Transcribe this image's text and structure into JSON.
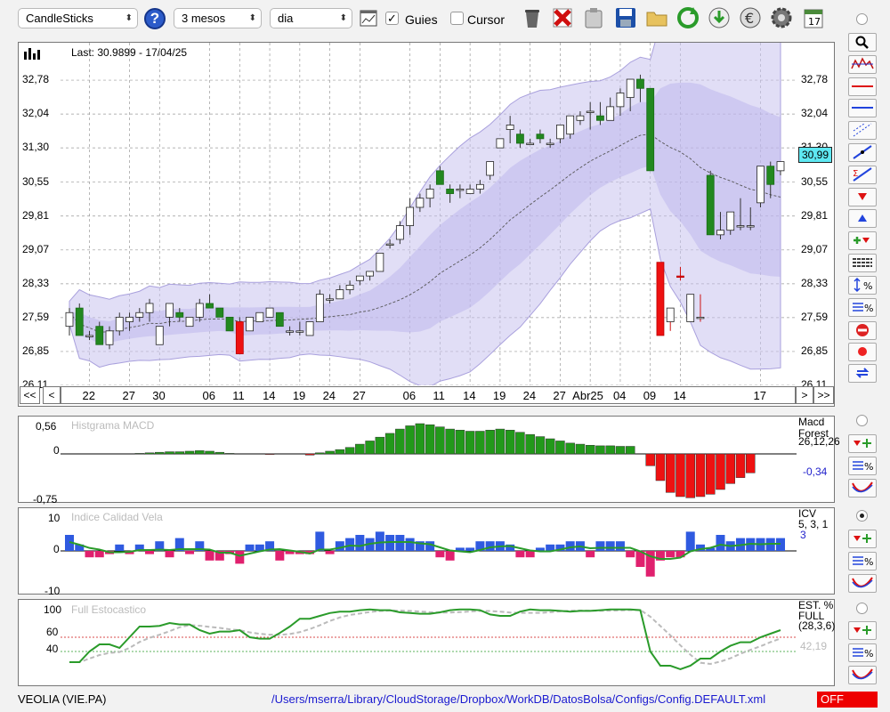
{
  "toolbar": {
    "chart_type": "CandleSticks",
    "period": "3 mesos",
    "interval": "dia",
    "guides_label": "Guies",
    "cursor_label": "Cursor"
  },
  "main_chart": {
    "last_label": "Last: 30.9899 - 17/04/25",
    "y_ticks": [
      "32,78",
      "32,04",
      "31,30",
      "30,55",
      "29,81",
      "29,07",
      "28,33",
      "27,59",
      "26,85",
      "26,11"
    ],
    "current_price": "30,99",
    "x_ticks": [
      "22",
      "27",
      "30",
      "06",
      "11",
      "14",
      "19",
      "24",
      "27",
      "06",
      "11",
      "14",
      "19",
      "24",
      "27",
      "Abr25",
      "04",
      "09",
      "14",
      "17"
    ],
    "nav": [
      "<<",
      "<",
      ">",
      ">>"
    ]
  },
  "macd": {
    "title": "Histgrama MACD",
    "y_ticks": [
      "0,56",
      "0",
      "-0,75"
    ],
    "side_name": "Macd",
    "side_name2": "Forest",
    "side_params": "26,12,26",
    "side_value": "-0,34"
  },
  "icv": {
    "title": "Indice Calidad Vela",
    "y_ticks": [
      "10",
      "0",
      "-10"
    ],
    "side_name": "ICV",
    "side_params": "5, 3, 1",
    "side_value": "3"
  },
  "stoch": {
    "title": "Full Estocastico",
    "y_ticks": [
      "100",
      "60",
      "40"
    ],
    "side_name": "EST. %",
    "side_name2": "FULL",
    "side_params": "(28,3,6)",
    "side_value": "42,19"
  },
  "footer": {
    "ticker": "VEOLIA (VIE.PA)",
    "path": "/Users/mserra/Library/CloudStorage/Dropbox/WorkDB/DatosBolsa/Configs/Config.DEFAULT.xml",
    "status": "OFF"
  },
  "chart_data": {
    "type": "candlestick",
    "ylim": [
      26.11,
      33.52
    ],
    "candles": [
      [
        27.4,
        27.8,
        27.2,
        27.7
      ],
      [
        27.8,
        27.9,
        27.2,
        27.2
      ],
      [
        27.2,
        27.3,
        27.1,
        27.2
      ],
      [
        27.4,
        27.5,
        27.0,
        27.0
      ],
      [
        27.0,
        27.4,
        26.9,
        27.3
      ],
      [
        27.3,
        27.7,
        27.2,
        27.6
      ],
      [
        27.5,
        27.7,
        27.3,
        27.6
      ],
      [
        27.6,
        27.8,
        27.5,
        27.7
      ],
      [
        27.7,
        28.0,
        27.5,
        27.9
      ],
      [
        27.0,
        27.4,
        27.0,
        27.4
      ],
      [
        27.6,
        27.9,
        27.4,
        27.9
      ],
      [
        27.7,
        27.8,
        27.5,
        27.6
      ],
      [
        27.4,
        27.6,
        27.4,
        27.6
      ],
      [
        27.6,
        28.0,
        27.5,
        27.9
      ],
      [
        27.9,
        28.1,
        27.8,
        27.8
      ],
      [
        27.8,
        27.8,
        27.6,
        27.6
      ],
      [
        27.6,
        27.6,
        27.3,
        27.3
      ],
      [
        27.5,
        27.6,
        26.8,
        26.8
      ],
      [
        27.3,
        27.6,
        27.3,
        27.6
      ],
      [
        27.5,
        27.7,
        27.5,
        27.7
      ],
      [
        27.6,
        27.8,
        27.6,
        27.8
      ],
      [
        27.7,
        27.7,
        27.4,
        27.4
      ],
      [
        27.3,
        27.4,
        27.2,
        27.3
      ],
      [
        27.3,
        27.5,
        27.2,
        27.3
      ],
      [
        27.2,
        27.5,
        27.2,
        27.5
      ],
      [
        27.5,
        28.2,
        27.5,
        28.1
      ],
      [
        28.0,
        28.1,
        27.9,
        28.0
      ],
      [
        28.0,
        28.3,
        28.0,
        28.2
      ],
      [
        28.2,
        28.4,
        28.1,
        28.3
      ],
      [
        28.4,
        28.5,
        28.3,
        28.5
      ],
      [
        28.5,
        28.6,
        28.4,
        28.6
      ],
      [
        28.6,
        29.0,
        28.6,
        29.0
      ],
      [
        29.2,
        29.3,
        29.1,
        29.2
      ],
      [
        29.3,
        29.7,
        29.2,
        29.6
      ],
      [
        29.6,
        30.2,
        29.4,
        30.0
      ],
      [
        30.0,
        30.3,
        29.9,
        30.2
      ],
      [
        30.2,
        30.5,
        30.0,
        30.4
      ],
      [
        30.8,
        30.9,
        30.5,
        30.5
      ],
      [
        30.4,
        30.5,
        30.1,
        30.3
      ],
      [
        30.4,
        30.5,
        30.2,
        30.4
      ],
      [
        30.3,
        30.5,
        30.3,
        30.4
      ],
      [
        30.4,
        30.6,
        30.3,
        30.5
      ],
      [
        30.7,
        31.0,
        30.6,
        31.0
      ],
      [
        31.3,
        31.5,
        31.3,
        31.5
      ],
      [
        31.7,
        32.0,
        31.4,
        31.8
      ],
      [
        31.6,
        31.7,
        31.3,
        31.4
      ],
      [
        31.4,
        31.5,
        31.4,
        31.4
      ],
      [
        31.6,
        31.7,
        31.4,
        31.5
      ],
      [
        31.4,
        31.5,
        31.3,
        31.4
      ],
      [
        31.5,
        31.8,
        31.4,
        31.8
      ],
      [
        31.6,
        32.0,
        31.5,
        32.0
      ],
      [
        31.9,
        32.1,
        31.8,
        32.0
      ],
      [
        32.1,
        32.3,
        31.7,
        32.1
      ],
      [
        32.0,
        32.3,
        31.8,
        31.9
      ],
      [
        31.9,
        32.4,
        31.9,
        32.2
      ],
      [
        32.2,
        32.6,
        32.0,
        32.5
      ],
      [
        32.4,
        32.8,
        32.1,
        32.8
      ],
      [
        32.8,
        32.9,
        32.3,
        32.6
      ],
      [
        32.6,
        32.6,
        30.8,
        30.8
      ],
      [
        28.8,
        28.8,
        27.2,
        27.2
      ],
      [
        27.5,
        27.8,
        27.3,
        27.8
      ],
      [
        28.5,
        28.7,
        28.4,
        28.5
      ],
      [
        27.5,
        28.1,
        27.5,
        28.1
      ],
      [
        27.6,
        28.1,
        27.5,
        27.6
      ],
      [
        30.7,
        30.8,
        29.4,
        29.4
      ],
      [
        29.4,
        29.9,
        29.3,
        29.5
      ],
      [
        29.5,
        29.9,
        29.4,
        29.9
      ],
      [
        29.6,
        30.2,
        29.5,
        29.6
      ],
      [
        29.6,
        30.0,
        29.5,
        29.6
      ],
      [
        30.1,
        30.9,
        30.0,
        30.9
      ],
      [
        30.9,
        31.0,
        30.2,
        30.5
      ],
      [
        30.8,
        31.0,
        30.7,
        31.0
      ]
    ]
  }
}
